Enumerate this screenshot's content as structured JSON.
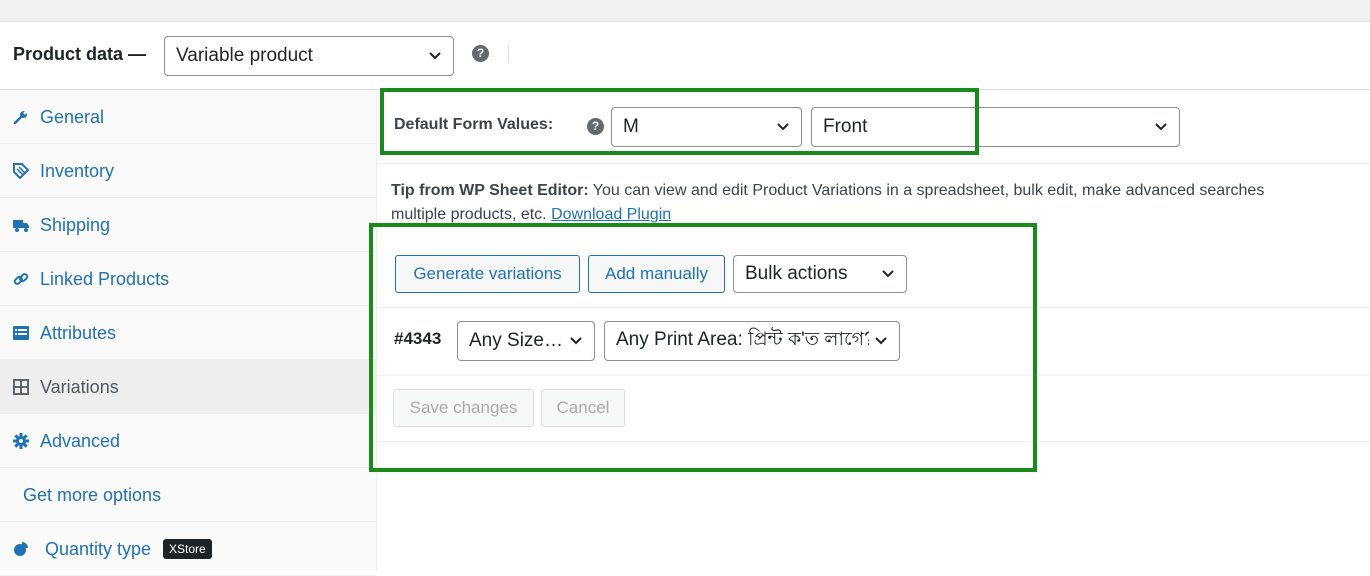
{
  "header": {
    "label": "Product data —",
    "product_type": "Variable product",
    "help": "?"
  },
  "sidebar": {
    "items": [
      {
        "label": "General",
        "icon": "wrench-icon"
      },
      {
        "label": "Inventory",
        "icon": "tag-icon"
      },
      {
        "label": "Shipping",
        "icon": "truck-icon"
      },
      {
        "label": "Linked Products",
        "icon": "link-icon"
      },
      {
        "label": "Attributes",
        "icon": "list-icon"
      },
      {
        "label": "Variations",
        "icon": "grid-icon"
      },
      {
        "label": "Advanced",
        "icon": "gear-icon"
      },
      {
        "label": "Get more options",
        "icon": ""
      },
      {
        "label": "Quantity type",
        "icon": "pie-icon",
        "badge": "XStore"
      }
    ]
  },
  "default_form": {
    "label": "Default Form Values:",
    "help": "?",
    "size_value": "M",
    "print_area_value": "Front"
  },
  "tip": {
    "bold": "Tip from WP Sheet Editor:",
    "text": " You can view and edit Product Variations in a spreadsheet, bulk edit, make advanced searches",
    "line2": "multiple products, etc. ",
    "link": "Download Plugin"
  },
  "toolbar": {
    "generate_label": "Generate variations",
    "add_label": "Add manually",
    "bulk_label": "Bulk actions"
  },
  "variation": {
    "id": "#4343",
    "size": "Any Size…",
    "print_area": "Any Print Area: প্রিন্ট ক'ত লাগে?"
  },
  "actions": {
    "save_label": "Save changes",
    "cancel_label": "Cancel"
  },
  "colors": {
    "highlight": "#1a8a1a",
    "link": "#2271b1"
  }
}
